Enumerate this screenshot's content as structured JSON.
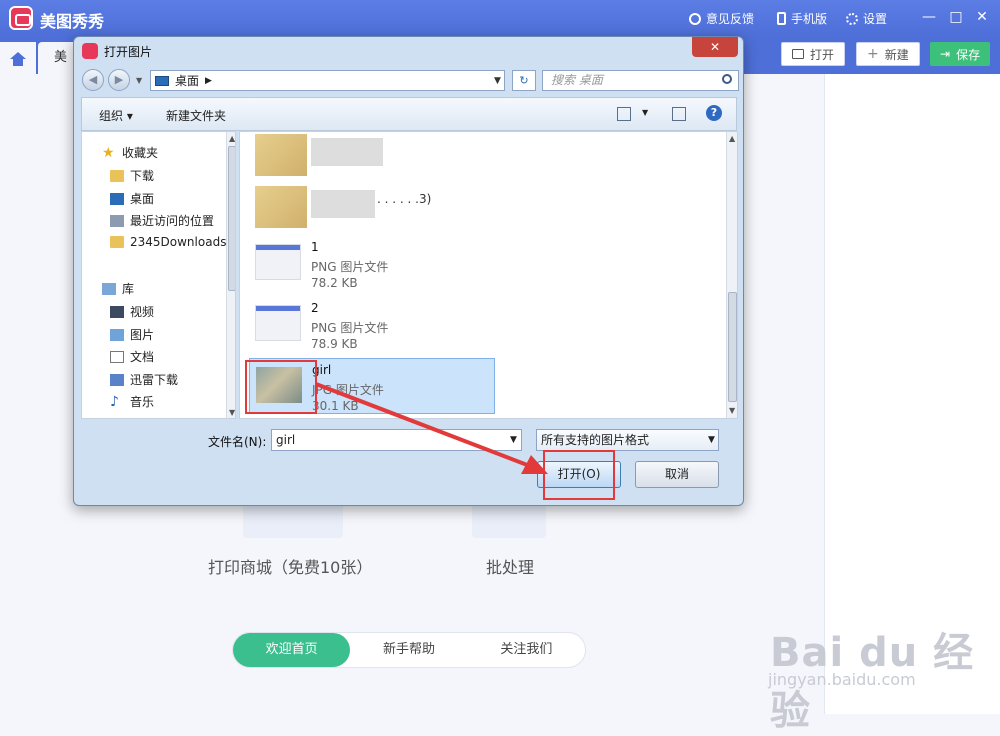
{
  "app": {
    "title": "美图秀秀",
    "feedback": "意见反馈",
    "mobile": "手机版",
    "settings": "设置",
    "tab_partial": "美",
    "open_label": "打开",
    "new_label": "新建",
    "save_label": "保存"
  },
  "home": {
    "feature1": "打印商城（免费10张）",
    "feature2": "批处理",
    "tabs": [
      "欢迎首页",
      "新手帮助",
      "关注我们"
    ]
  },
  "watermark": {
    "brand": "Bai du 经验",
    "url": "jingyan.baidu.com"
  },
  "dialog": {
    "title": "打开图片",
    "address": "桌面",
    "search_placeholder": "搜索 桌面",
    "organize": "组织 ▾",
    "new_folder": "新建文件夹",
    "tree": {
      "favorites": "收藏夹",
      "download": "下载",
      "desktop": "桌面",
      "recent": "最近访问的位置",
      "downloads2345": "2345Downloads",
      "library": "库",
      "video": "视频",
      "pictures": "图片",
      "docs": "文档",
      "xunlei": "迅雷下载",
      "music": "音乐"
    },
    "files": [
      {
        "name": "",
        "type": "",
        "size": ""
      },
      {
        "name": ". . . . . .3)",
        "type": "",
        "size": ""
      },
      {
        "name": "1",
        "type": "PNG 图片文件",
        "size": "78.2 KB"
      },
      {
        "name": "2",
        "type": "PNG 图片文件",
        "size": "78.9 KB"
      },
      {
        "name": "girl",
        "type": "JPG 图片文件",
        "size": "30.1 KB"
      }
    ],
    "filename_label": "文件名(N):",
    "filename_value": "girl",
    "filetype": "所有支持的图片格式",
    "open_button": "打开(O)",
    "cancel_button": "取消"
  },
  "colors": {
    "brand_blue": "#4e6fd8",
    "save_green": "#3cc07a",
    "annotation_red": "#e23a3a"
  }
}
